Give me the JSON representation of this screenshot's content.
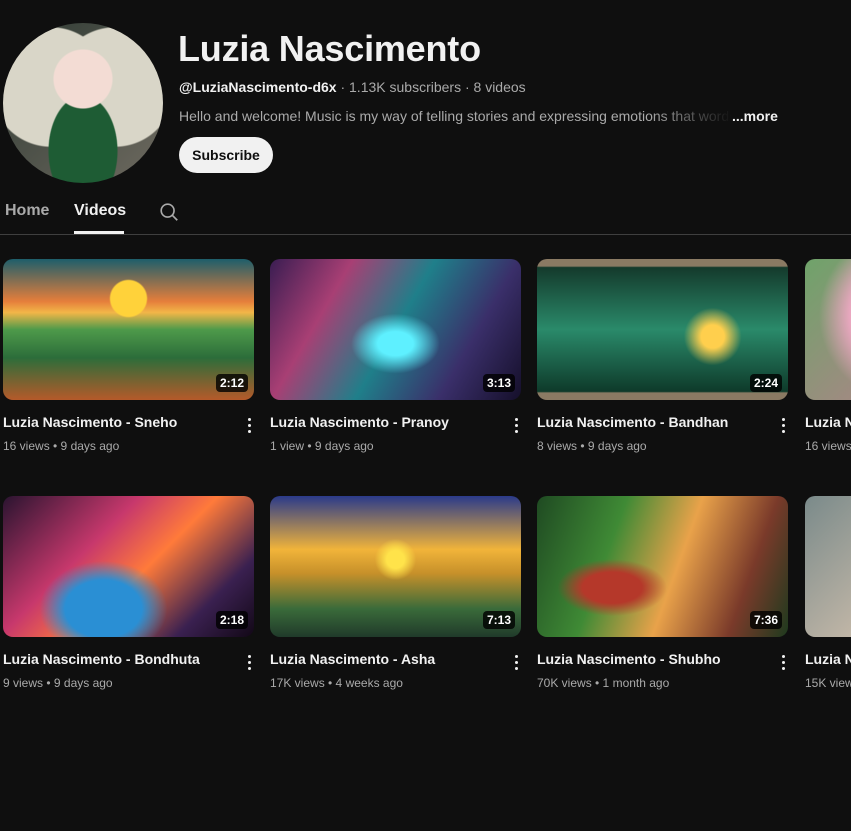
{
  "channel": {
    "name": "Luzia Nascimento",
    "handle": "@LuziaNascimento-d6x",
    "stats": " · 1.13K subscribers · 8 videos",
    "description": "Hello and welcome! Music is my way of telling stories and expressing emotions that words can't",
    "more_label": "...more",
    "subscribe_label": "Subscribe"
  },
  "tabs": {
    "home": "Home",
    "videos": "Videos"
  },
  "videos": [
    {
      "title": "Luzia Nascimento - Sneho",
      "stats": "16 views • 9 days ago",
      "duration": "2:12"
    },
    {
      "title": "Luzia Nascimento - Pranoy",
      "stats": "1 view • 9 days ago",
      "duration": "3:13"
    },
    {
      "title": "Luzia Nascimento - Bandhan",
      "stats": "8 views • 9 days ago",
      "duration": "2:24"
    },
    {
      "title": "Luzia N",
      "stats": "16 views",
      "duration": ""
    },
    {
      "title": "Luzia Nascimento - Bondhuta",
      "stats": "9 views • 9 days ago",
      "duration": "2:18"
    },
    {
      "title": "Luzia Nascimento - Asha",
      "stats": "17K views • 4 weeks ago",
      "duration": "7:13"
    },
    {
      "title": "Luzia Nascimento - Shubho",
      "stats": "70K views • 1 month ago",
      "duration": "7:36"
    },
    {
      "title": "Luzia N",
      "stats": "15K view",
      "duration": ""
    }
  ]
}
